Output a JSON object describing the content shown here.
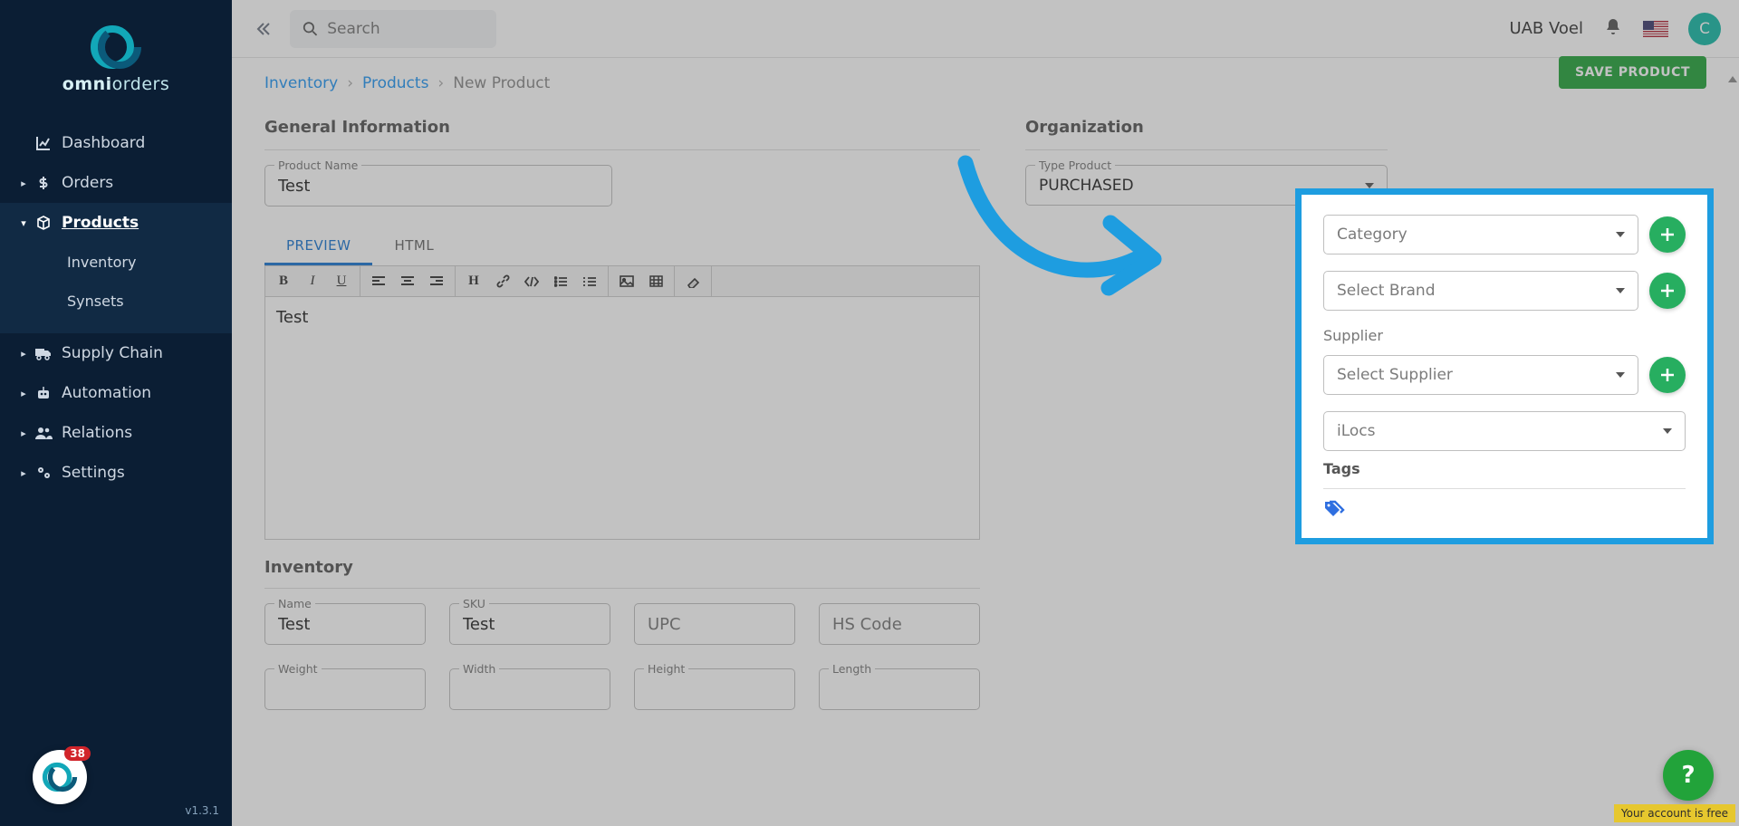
{
  "brand": {
    "part1": "omni",
    "part2": "orders"
  },
  "sidebar": {
    "items": [
      {
        "label": "Dashboard",
        "icon": "chart"
      },
      {
        "label": "Orders",
        "icon": "dollar"
      },
      {
        "label": "Products",
        "icon": "cube"
      },
      {
        "label": "Supply Chain",
        "icon": "truck"
      },
      {
        "label": "Automation",
        "icon": "robot"
      },
      {
        "label": "Relations",
        "icon": "people"
      },
      {
        "label": "Settings",
        "icon": "gears"
      }
    ],
    "subitems": [
      {
        "label": "Inventory"
      },
      {
        "label": "Synsets"
      }
    ],
    "badge": "38",
    "version": "v1.3.1"
  },
  "topbar": {
    "search_placeholder": "Search",
    "org": "UAB Voel",
    "avatar_initial": "C"
  },
  "crumbs": {
    "a": "Inventory",
    "b": "Products",
    "c": "New Product"
  },
  "save_button": "SAVE PRODUCT",
  "form": {
    "general_title": "General Information",
    "product_name_label": "Product Name",
    "product_name_value": "Test",
    "tabs": {
      "preview": "PREVIEW",
      "html": "HTML"
    },
    "editor_content": "Test",
    "inventory_title": "Inventory",
    "fields": {
      "name_label": "Name",
      "name_value": "Test",
      "sku_label": "SKU",
      "sku_value": "Test",
      "upc_placeholder": "UPC",
      "hs_placeholder": "HS Code",
      "weight_label": "Weight",
      "width_label": "Width",
      "height_label": "Height",
      "length_label": "Length"
    }
  },
  "organization": {
    "title": "Organization",
    "type_label": "Type Product",
    "type_value": "PURCHASED",
    "category": "Category",
    "brand": "Select Brand",
    "supplier_label": "Supplier",
    "supplier_select": "Select Supplier",
    "ilocs": "iLocs",
    "tags_label": "Tags"
  },
  "free_banner": "Your account is free"
}
